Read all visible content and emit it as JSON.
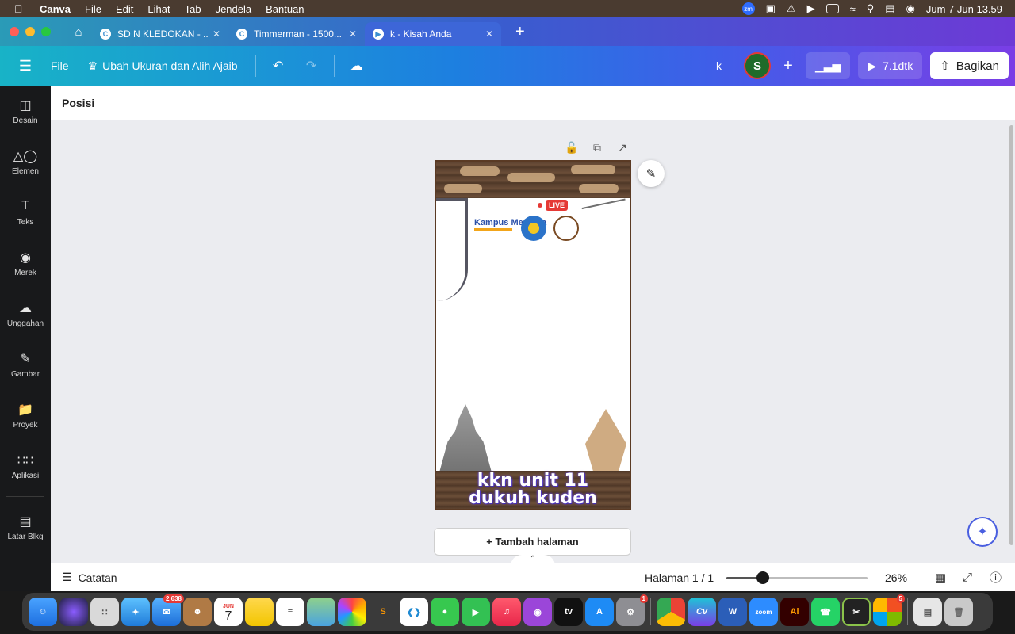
{
  "menubar": {
    "app": "Canva",
    "items": [
      "File",
      "Edit",
      "Lihat",
      "Tab",
      "Jendela",
      "Bantuan"
    ],
    "clock": "Jum 7 Jun  13.59",
    "zoom_badge": "zm"
  },
  "browser": {
    "tabs": [
      {
        "title": "SD N KLEDOKAN - ...",
        "icon": "canva-favicon"
      },
      {
        "title": "Timmerman - 1500...",
        "icon": "canva-favicon"
      },
      {
        "title": "k - Kisah Anda",
        "icon": "video-favicon",
        "active": true
      }
    ],
    "new_tab": "+"
  },
  "toolbar": {
    "file": "File",
    "title": "Ubah Ukuran dan Alih Ajaib",
    "doc_name": "k",
    "avatar_initial": "S",
    "play_label": "7.1dtk",
    "share_label": "Bagikan"
  },
  "sidebar": {
    "items": [
      {
        "label": "Desain",
        "icon": "layout-icon"
      },
      {
        "label": "Elemen",
        "icon": "shapes-icon"
      },
      {
        "label": "Teks",
        "icon": "text-icon"
      },
      {
        "label": "Merek",
        "icon": "brand-icon"
      },
      {
        "label": "Unggahan",
        "icon": "upload-cloud-icon"
      },
      {
        "label": "Gambar",
        "icon": "draw-icon"
      },
      {
        "label": "Proyek",
        "icon": "folder-icon"
      },
      {
        "label": "Aplikasi",
        "icon": "apps-grid-icon"
      },
      {
        "label": "Latar Blkg",
        "icon": "background-icon"
      }
    ]
  },
  "position_bar": {
    "label": "Posisi"
  },
  "design": {
    "live_badge": "LIVE",
    "logo_text": "Kampus Merdeka",
    "caption_line1": "kkn unit 11",
    "caption_line2": "dukuh kuden"
  },
  "canvas": {
    "add_page": "+ Tambah halaman"
  },
  "footer": {
    "notes": "Catatan",
    "page_info": "Halaman 1 / 1",
    "zoom": "26%",
    "zoom_fraction": 0.26
  },
  "dock": {
    "mail_badge": "2.638",
    "calendar_month": "JUN",
    "calendar_day": "7",
    "settings_badge": "1",
    "extra_badge": "5",
    "apps": [
      "Finder",
      "Siri",
      "Launchpad",
      "Safari",
      "Mail",
      "Contacts",
      "Calendar",
      "Notes",
      "Reminders",
      "Maps",
      "Photos",
      "Sublime Text",
      "VS Code",
      "Messages",
      "FaceTime",
      "Music",
      "Podcasts",
      "Apple TV",
      "App Store",
      "System Settings",
      "Chrome",
      "Canva",
      "Word",
      "Zoom",
      "Illustrator",
      "WhatsApp",
      "Shotcut",
      "Office",
      "Preview",
      "Trash"
    ]
  }
}
